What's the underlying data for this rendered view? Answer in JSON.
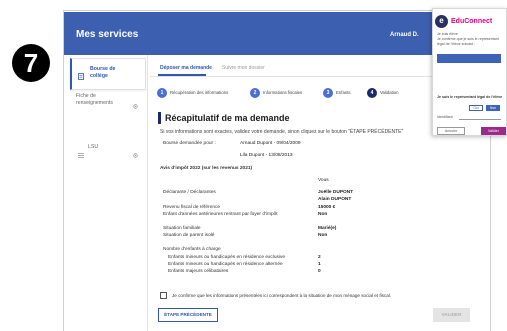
{
  "step_badge": "7",
  "header": {
    "title": "Mes services",
    "user": "Arnaud D."
  },
  "sidebar": {
    "items": [
      {
        "label": "Bourse de collège",
        "icon": "document-icon",
        "active": true
      },
      {
        "label": "Fiche de renseignements",
        "icon": "gear-icon",
        "active": false
      },
      {
        "label": "LSU",
        "icon": "list-icon",
        "active": false
      }
    ]
  },
  "tabs": [
    {
      "label": "Déposer ma demande",
      "active": true
    },
    {
      "label": "Suivre mon dossier",
      "active": false
    }
  ],
  "stepper": [
    {
      "number": "1",
      "label": "Récupération des informations"
    },
    {
      "number": "2",
      "label": "Informations fiscales"
    },
    {
      "number": "3",
      "label": "Enfants"
    },
    {
      "number": "4",
      "label": "Validation",
      "current": true
    }
  ],
  "recap": {
    "title": "Récapitulatif de ma demande",
    "intro": "Si vos informations sont exactes, validez votre demande, sinon cliquez sur le bouton \"ÉTAPE PRÉCÉDENTE\"",
    "bourse_label": "Bourse demandée pour :",
    "children": [
      "Arnaud Dupont - 09/04/2009",
      "Lila Dupont - 13/08/2013"
    ],
    "tax_notice_title": "Avis d'impôt 2022 (sur les revenus 2021)",
    "column_header": "Vous",
    "declarants_label": "Déclarante / Déclarantes",
    "declarants": [
      "Joëlle DUPONT",
      "Alain DUPONT"
    ],
    "fields": [
      {
        "label": "Revenu fiscal de référence",
        "value": "15000 €"
      },
      {
        "label": "Enfant d'années antérieures rentrant par foyer d'impôt",
        "value": "Non"
      },
      {
        "label": "Situation familiale",
        "value": "Marié(e)"
      },
      {
        "label": "Situation de parent isolé",
        "value": "Non"
      }
    ],
    "dependents_title": "Nombre d'enfants à charge",
    "dependents": [
      {
        "label": "Enfants mineurs ou handicapés en résidence exclusive",
        "value": "2"
      },
      {
        "label": "Enfants mineurs ou handicapés en résidence alternée",
        "value": "1"
      },
      {
        "label": "Enfants majeurs célibataires",
        "value": "0"
      }
    ],
    "confirm_label": "Je confirme que les informations présentées ici correspondent à la situation de mon ménage social et fiscal.",
    "confirm_checked": false,
    "prev_button": "ÉTAPE PRÉCÉDENTE",
    "validate_button": "VALIDER"
  },
  "popup": {
    "brand": "EduConnect",
    "logo_letter": "e",
    "line1": "Je suis élève",
    "line2": "Je confirme que je suis le représentant légal de l'élève suivant :",
    "question": "Je suis le représentant légal de l'élève",
    "yes": "Oui",
    "no": "Non",
    "id_label": "Identifiant",
    "cancel": "Annuler",
    "submit": "Valider"
  },
  "colors": {
    "header_bg": "#3c5fb0",
    "accent": "#2f57b3",
    "step_done": "#4a6fd4",
    "step_current": "#1b2a6b",
    "disabled_bg": "#e4e4e4",
    "brand_pink": "#e6007e",
    "popup_blue": "#3d63b8",
    "popup_submit": "#9b2a8a"
  }
}
